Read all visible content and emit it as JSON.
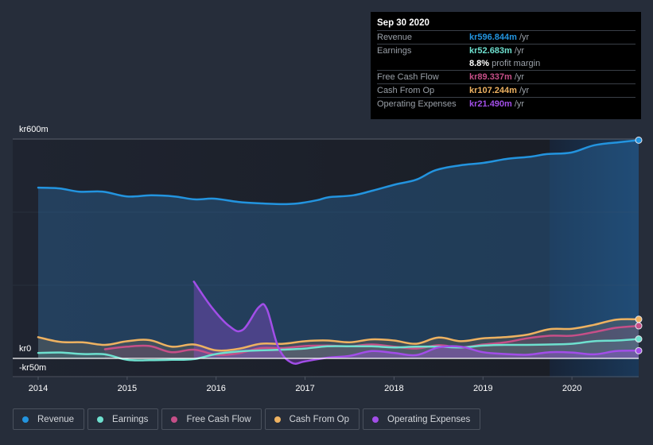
{
  "tooltip": {
    "date": "Sep 30 2020",
    "rows": [
      {
        "label": "Revenue",
        "value": "kr596.844m",
        "unit": "/yr",
        "color": "#2394df"
      },
      {
        "label": "Earnings",
        "value": "kr52.683m",
        "unit": "/yr",
        "color": "#6ee0cf"
      },
      {
        "label": "",
        "value": "8.8%",
        "unit": "profit margin",
        "color": "#ffffff"
      },
      {
        "label": "Free Cash Flow",
        "value": "kr89.337m",
        "unit": "/yr",
        "color": "#c64f88"
      },
      {
        "label": "Cash From Op",
        "value": "kr107.244m",
        "unit": "/yr",
        "color": "#eeb261"
      },
      {
        "label": "Operating Expenses",
        "value": "kr21.490m",
        "unit": "/yr",
        "color": "#a24ee8"
      }
    ]
  },
  "legend": [
    {
      "label": "Revenue",
      "color": "#2394df"
    },
    {
      "label": "Earnings",
      "color": "#6ee0cf"
    },
    {
      "label": "Free Cash Flow",
      "color": "#c64f88"
    },
    {
      "label": "Cash From Op",
      "color": "#eeb261"
    },
    {
      "label": "Operating Expenses",
      "color": "#a24ee8"
    }
  ],
  "chart_data": {
    "type": "area",
    "title": "",
    "xlabel": "",
    "ylabel": "",
    "currency_prefix": "kr",
    "ylim": [
      -50,
      600
    ],
    "y_tick_labels": [
      "kr600m",
      "kr0",
      "-kr50m"
    ],
    "y_ticks": [
      600,
      0,
      -50
    ],
    "x_tick_labels": [
      "2014",
      "2015",
      "2016",
      "2017",
      "2018",
      "2019",
      "2020"
    ],
    "x_ticks": [
      2014,
      2015,
      2016,
      2017,
      2018,
      2019,
      2020
    ],
    "xlim": [
      2014,
      2020.75
    ],
    "grid": true,
    "legend_position": "bottom-left",
    "highlight_start": 2019.75,
    "series": [
      {
        "name": "Revenue",
        "color": "#2394df",
        "x": [
          2014.0,
          2014.24,
          2014.46,
          2014.73,
          2015.0,
          2015.27,
          2015.53,
          2015.76,
          2015.98,
          2016.25,
          2016.51,
          2016.74,
          2016.92,
          2017.14,
          2017.27,
          2017.54,
          2017.76,
          2018.02,
          2018.25,
          2018.47,
          2018.74,
          2019.01,
          2019.28,
          2019.54,
          2019.72,
          2019.99,
          2020.25,
          2020.52,
          2020.75
        ],
        "values": [
          467,
          465,
          456,
          456,
          443,
          446,
          443,
          435,
          437,
          428,
          424,
          422,
          424,
          433,
          441,
          446,
          459,
          476,
          489,
          515,
          528,
          535,
          546,
          552,
          559,
          563,
          583,
          591,
          597
        ]
      },
      {
        "name": "Earnings",
        "color": "#6ee0cf",
        "x": [
          2014.0,
          2014.25,
          2014.5,
          2014.75,
          2015.0,
          2015.25,
          2015.5,
          2015.75,
          2016.0,
          2016.25,
          2016.5,
          2016.75,
          2017.0,
          2017.25,
          2017.5,
          2017.75,
          2018.0,
          2018.25,
          2018.5,
          2018.75,
          2019.0,
          2019.25,
          2019.5,
          2019.75,
          2020.0,
          2020.25,
          2020.5,
          2020.75
        ],
        "values": [
          15,
          16,
          12,
          11,
          -4,
          -5,
          -4,
          -2,
          12,
          19,
          22,
          24,
          27,
          33,
          33,
          33,
          30,
          32,
          32,
          30,
          35,
          37,
          37,
          38,
          40,
          47,
          49,
          53
        ]
      },
      {
        "name": "Free Cash Flow",
        "color": "#c64f88",
        "x": [
          2014.75,
          2015.0,
          2015.25,
          2015.5,
          2015.75,
          2016.0,
          2016.25,
          2016.5,
          2016.75,
          2017.0,
          2017.25,
          2017.5,
          2017.75,
          2018.0,
          2018.25,
          2018.5,
          2018.75,
          2019.0,
          2019.25,
          2019.5,
          2019.75,
          2020.0,
          2020.25,
          2020.5,
          2020.75
        ],
        "values": [
          25,
          32,
          34,
          17,
          24,
          10,
          14,
          28,
          28,
          34,
          35,
          33,
          38,
          32,
          27,
          36,
          30,
          38,
          44,
          55,
          62,
          62,
          72,
          84,
          89
        ]
      },
      {
        "name": "Cash From Op",
        "color": "#eeb261",
        "x": [
          2014.0,
          2014.25,
          2014.5,
          2014.75,
          2015.0,
          2015.25,
          2015.5,
          2015.75,
          2016.0,
          2016.25,
          2016.5,
          2016.75,
          2017.0,
          2017.25,
          2017.5,
          2017.75,
          2018.0,
          2018.25,
          2018.5,
          2018.75,
          2019.0,
          2019.25,
          2019.5,
          2019.75,
          2020.0,
          2020.25,
          2020.5,
          2020.75
        ],
        "values": [
          58,
          45,
          44,
          37,
          47,
          50,
          32,
          38,
          22,
          26,
          40,
          40,
          47,
          49,
          44,
          52,
          49,
          40,
          57,
          47,
          55,
          58,
          65,
          80,
          81,
          92,
          106,
          107
        ]
      },
      {
        "name": "Operating Expenses",
        "color": "#a24ee8",
        "x": [
          2015.75,
          2015.95,
          2016.15,
          2016.3,
          2016.48,
          2016.57,
          2016.7,
          2016.85,
          2017.0,
          2017.25,
          2017.5,
          2017.75,
          2018.0,
          2018.25,
          2018.5,
          2018.75,
          2019.0,
          2019.25,
          2019.5,
          2019.75,
          2020.0,
          2020.25,
          2020.5,
          2020.75
        ],
        "values": [
          210,
          140,
          88,
          78,
          140,
          135,
          30,
          -12,
          -8,
          2,
          7,
          20,
          15,
          9,
          30,
          32,
          17,
          12,
          10,
          17,
          16,
          11,
          20,
          21
        ]
      }
    ]
  }
}
